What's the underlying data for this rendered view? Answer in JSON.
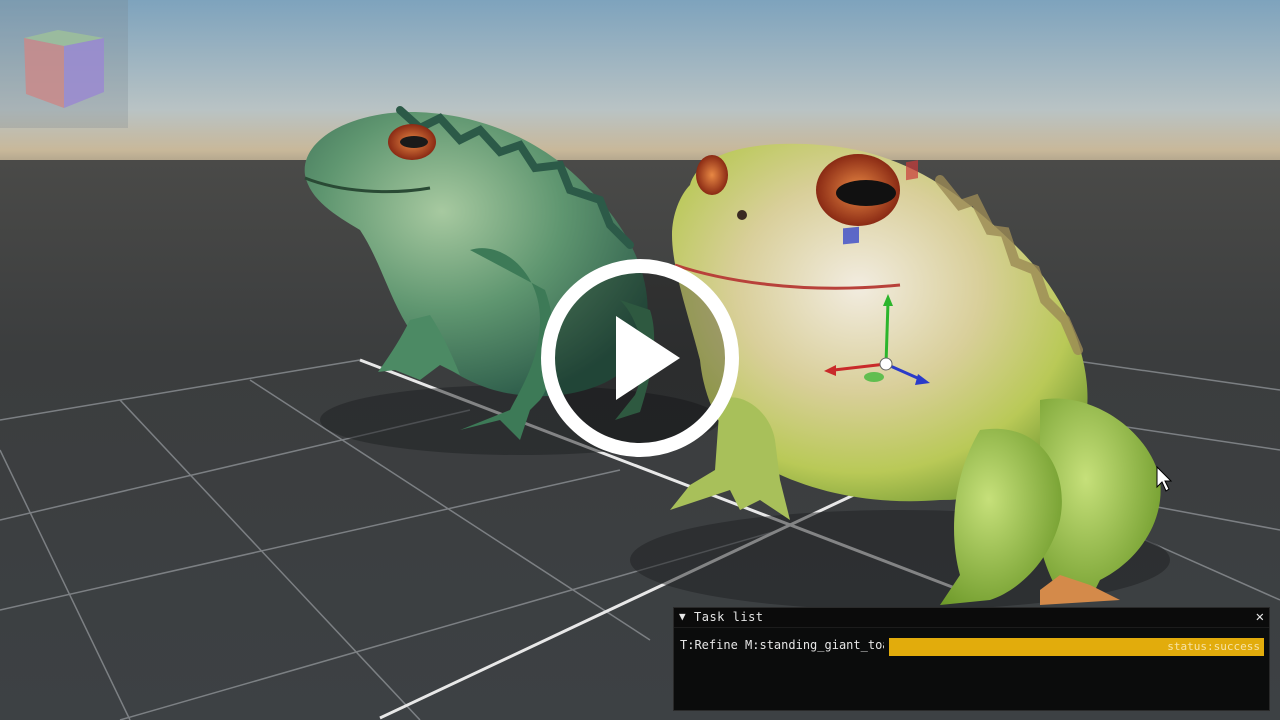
{
  "task_panel": {
    "title": "Task list",
    "collapse_icon": "triangle-down-icon",
    "close_icon": "close-icon",
    "tasks": [
      {
        "label": "T:Refine M:standing_giant_toa",
        "status": "status:success",
        "progress": 1.0
      }
    ]
  },
  "viewport": {
    "nav_cube_icon": "cube-icon",
    "play_icon": "play-icon",
    "gizmo_icon": "transform-gizmo-icon",
    "sky_color": "#7fa4be",
    "floor_color": "#3c4043"
  },
  "colors": {
    "accent": "#e2ac0c",
    "panel_bg": "#080808"
  }
}
